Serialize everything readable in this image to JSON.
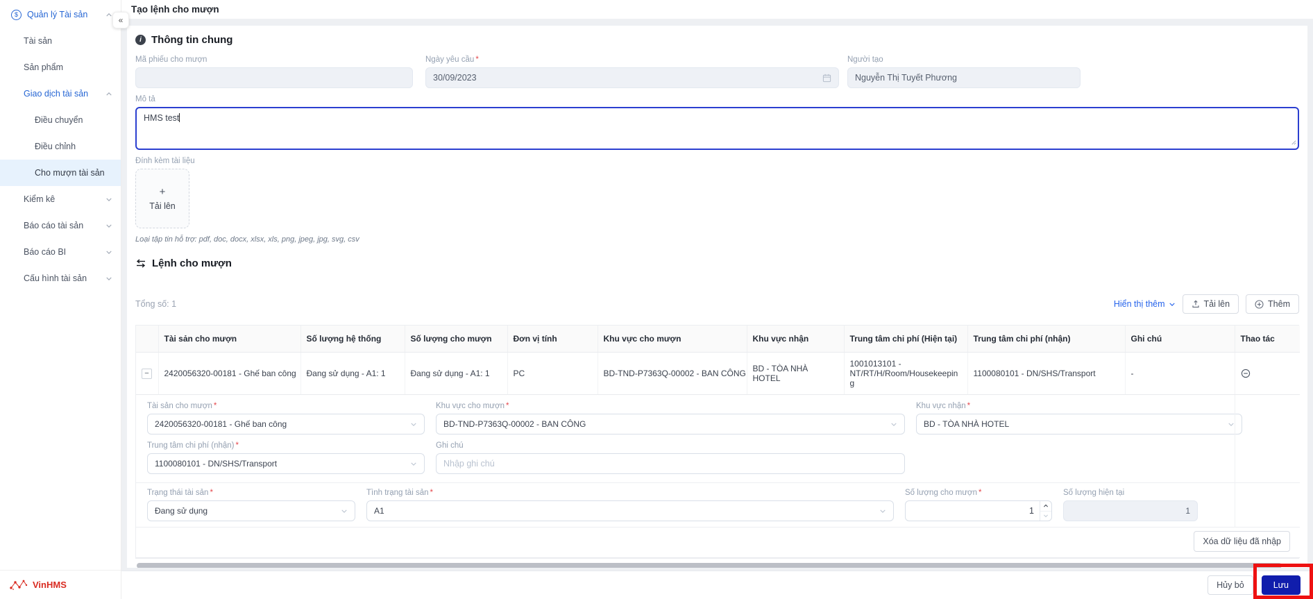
{
  "icons": {
    "collapse": "«",
    "info": "i",
    "row_expand": "−",
    "upload_plus": "+"
  },
  "required_mark": "*",
  "colors": {
    "accent_blue": "#2666d4",
    "link_blue": "#2563eb",
    "primary_button": "#101dac",
    "brand_red": "#d92b21",
    "annotation_red": "#ee1111",
    "selected_item_bg": "#e7f2fd"
  },
  "sidebar": {
    "items": [
      {
        "label": "Quản lý Tài sản",
        "level": 0,
        "arrow": "up"
      },
      {
        "label": "Tài sản",
        "level": 1
      },
      {
        "label": "Sản phẩm",
        "level": 1
      },
      {
        "label": "Giao dịch tài sản",
        "level": 1,
        "arrow": "up"
      },
      {
        "label": "Điều chuyển",
        "level": 2
      },
      {
        "label": "Điều chỉnh",
        "level": 2
      },
      {
        "label": "Cho mượn tài sản",
        "level": 2,
        "selected": true
      },
      {
        "label": "Kiểm kê",
        "level": 1,
        "arrow": "down"
      },
      {
        "label": "Báo cáo tài sản",
        "level": 1,
        "arrow": "down"
      },
      {
        "label": "Báo cáo BI",
        "level": 1,
        "arrow": "down"
      },
      {
        "label": "Cấu hình tài sản",
        "level": 1,
        "arrow": "down"
      }
    ],
    "logo_text": "VinHMS"
  },
  "header": {
    "title": "Tạo lệnh cho mượn"
  },
  "general": {
    "section_title": "Thông tin chung",
    "ma_phieu_label": "Mã phiếu cho mượn",
    "ma_phieu_value": "",
    "ngay_yeu_cau_label": "Ngày yêu cầu",
    "ngay_yeu_cau_value": "30/09/2023",
    "nguoi_tao_label": "Người tạo",
    "nguoi_tao_value": "Nguyễn Thị Tuyết Phương",
    "mo_ta_label": "Mô tả",
    "mo_ta_value": "HMS test",
    "dinh_kem_label": "Đính kèm tài liệu",
    "upload_text": "Tải lên",
    "file_hint": "Loại tập tin hỗ trợ: pdf, doc, docx, xlsx, xls, png, jpeg, jpg, svg, csv"
  },
  "loan": {
    "section_title": "Lệnh cho mượn",
    "total_label": "Tổng số: 1",
    "show_more": "Hiển thị thêm",
    "upload_button": "Tải lên",
    "add_button": "Thêm",
    "table": {
      "headers": [
        "Tài sản cho mượn",
        "Số lượng hệ thống",
        "Số lượng cho mượn",
        "Đơn vị tính",
        "Khu vực cho mượn",
        "Khu vực nhận",
        "Trung tâm chi phí (Hiện tại)",
        "Trung tâm chi phí (nhận)",
        "Ghi chú",
        "Thao tác"
      ],
      "row": [
        "2420056320-00181 - Ghế ban công",
        "Đang sử dụng - A1: 1",
        "Đang sử dụng - A1: 1",
        "PC",
        "BD-TND-P7363Q-00002 - BAN CÔNG",
        "BD - TÒA NHÀ HOTEL",
        "1001013101 - NT/RT/H/Room/Housekeeping",
        "1100080101 - DN/SHS/Transport",
        "-"
      ]
    },
    "detail": {
      "tai_san_label": "Tài sản cho mượn",
      "tai_san_value": "2420056320-00181 - Ghế ban công",
      "khu_vuc_cho_muon_label": "Khu vực cho mượn",
      "khu_vuc_cho_muon_value": "BD-TND-P7363Q-00002 - BAN CÔNG",
      "khu_vuc_nhan_label": "Khu vực nhận",
      "khu_vuc_nhan_value": "BD - TÒA NHÀ HOTEL",
      "trung_tam_label": "Trung tâm chi phí (nhận)",
      "trung_tam_value": "1100080101 - DN/SHS/Transport",
      "ghi_chu_label": "Ghi chú",
      "ghi_chu_placeholder": "Nhập ghi chú",
      "trang_thai_label": "Trạng thái tài sản",
      "trang_thai_value": "Đang sử dụng",
      "tinh_trang_label": "Tình trạng tài sản",
      "tinh_trang_value": "A1",
      "sl_cho_muon_label": "Số lượng cho mượn",
      "sl_cho_muon_value": "1",
      "sl_hien_tai_label": "Số lượng hiện tại",
      "sl_hien_tai_value": "1",
      "clear_button": "Xóa dữ liệu đã nhập"
    }
  },
  "footer": {
    "cancel": "Hủy bỏ",
    "save": "Lưu"
  }
}
